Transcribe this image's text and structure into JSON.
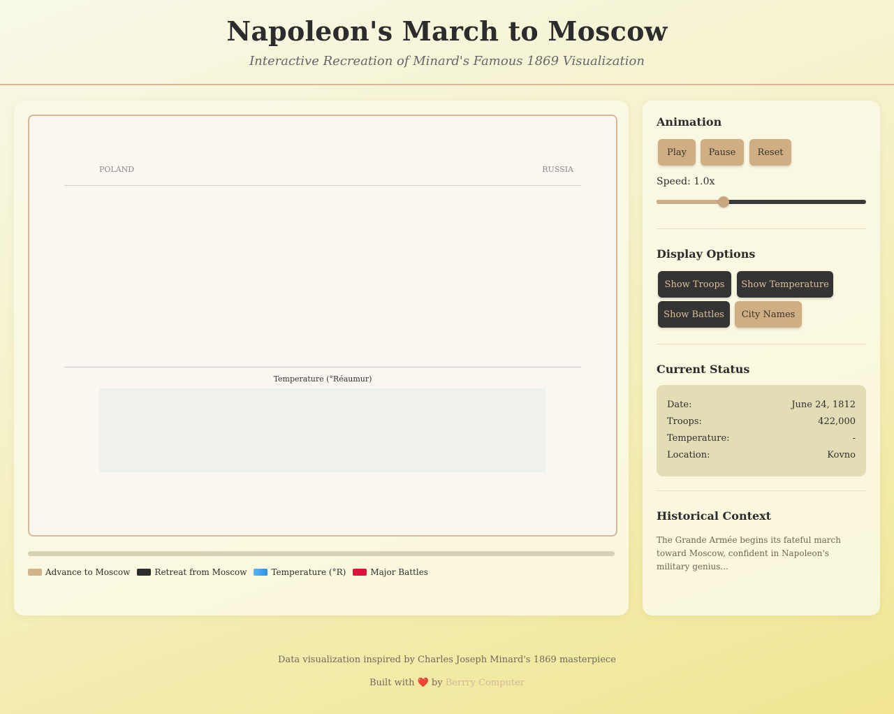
{
  "header": {
    "title": "Napoleon's March to Moscow",
    "subtitle": "Interactive Recreation of Minard's Famous 1869 Visualization"
  },
  "map": {
    "region_left": "POLAND",
    "region_right": "RUSSIA",
    "temperature_title": "Temperature (°Réaumur)",
    "progress_fraction": 0
  },
  "legend": [
    {
      "label": "Advance to Moscow",
      "color": "#d2b48c"
    },
    {
      "label": "Retreat from Moscow",
      "color": "#2d2d2d"
    },
    {
      "label": "Temperature (°R)",
      "color": "#3ea8f0"
    },
    {
      "label": "Major Battles",
      "color": "#dc143c"
    }
  ],
  "controls": {
    "animation_title": "Animation",
    "play_label": "Play",
    "pause_label": "Pause",
    "reset_label": "Reset",
    "speed_label": "Speed: 1.0x",
    "speed_fraction": 0.32,
    "display_title": "Display Options",
    "show_troops_label": "Show Troops",
    "show_temperature_label": "Show Temperature",
    "show_battles_label": "Show Battles",
    "city_names_label": "City Names"
  },
  "status": {
    "title": "Current Status",
    "date_label": "Date:",
    "date_value": "June 24, 1812",
    "troops_label": "Troops:",
    "troops_value": "422,000",
    "temperature_label": "Temperature:",
    "temperature_value": "-",
    "location_label": "Location:",
    "location_value": "Kovno"
  },
  "context": {
    "title": "Historical Context",
    "text": "The Grande Armée begins its fateful march toward Moscow, confident in Napoleon's military genius..."
  },
  "footer": {
    "line1": "Data visualization inspired by Charles Joseph Minard's 1869 masterpiece",
    "built_with": "Built with",
    "heart": "❤️",
    "by": "by",
    "link": "Berrry Computer"
  }
}
